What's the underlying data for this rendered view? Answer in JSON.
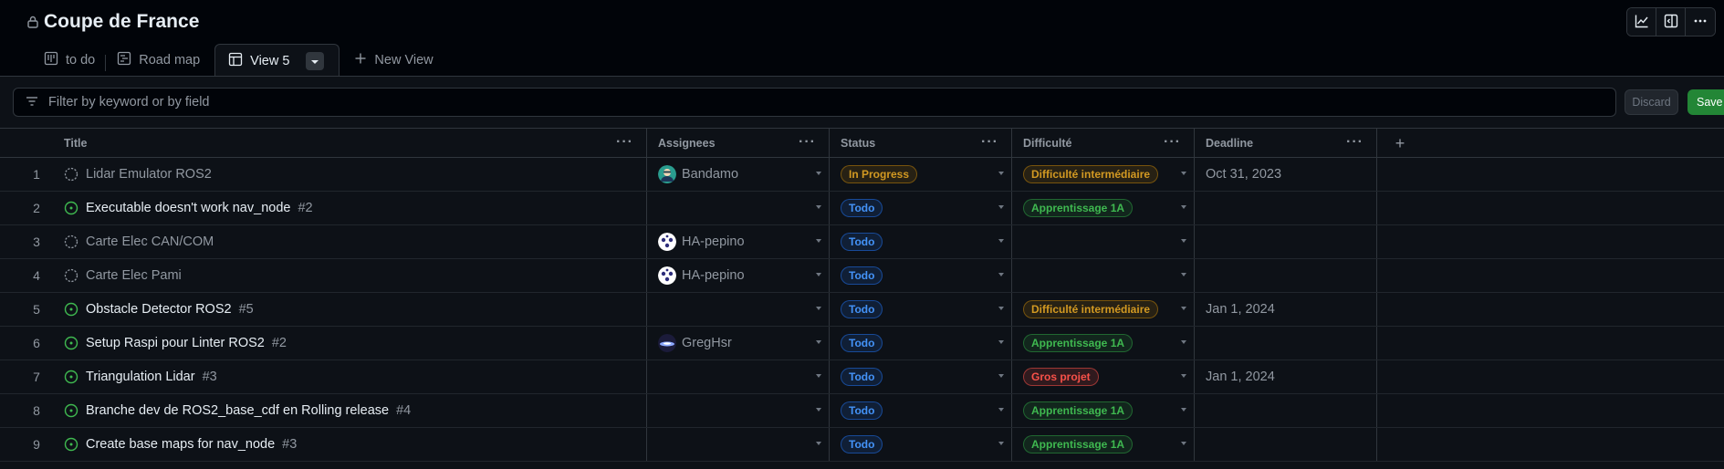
{
  "project": {
    "title": "Coupe de France",
    "lock_icon": "lock-icon"
  },
  "top_actions": [
    "graph-icon",
    "sidebar-icon",
    "kebab-icon"
  ],
  "tabs": [
    {
      "label": "to do",
      "icon": "board-icon"
    },
    {
      "label": "Road map",
      "icon": "roadmap-icon"
    },
    {
      "label": "View 5",
      "icon": "table-icon",
      "active": true
    },
    {
      "label": "New View",
      "icon": "plus-icon"
    }
  ],
  "filter": {
    "placeholder": "Filter by keyword or by field",
    "value": "",
    "discard_label": "Discard",
    "save_label": "Save"
  },
  "columns": {
    "title": "Title",
    "assignees": "Assignees",
    "status": "Status",
    "difficulty": "Difficulté",
    "deadline": "Deadline",
    "more": "···",
    "add": "+"
  },
  "rows": [
    {
      "num": "1",
      "title": "Lidar Emulator ROS2",
      "issue": "",
      "type": "draft",
      "assignee": "Bandamo",
      "avatar": "a1",
      "status": "In Progress",
      "status_kind": "inprogress",
      "difficulty": "Difficulté intermédiaire",
      "diff_kind": "inter",
      "deadline": "Oct 31, 2023"
    },
    {
      "num": "2",
      "title": "Executable doesn't work nav_node",
      "issue": "#2",
      "type": "issue",
      "assignee": "",
      "avatar": "",
      "status": "Todo",
      "status_kind": "todo",
      "difficulty": "Apprentissage 1A",
      "diff_kind": "app",
      "deadline": ""
    },
    {
      "num": "3",
      "title": "Carte Elec CAN/COM",
      "issue": "",
      "type": "draft",
      "assignee": "HA-pepino",
      "avatar": "a2",
      "status": "Todo",
      "status_kind": "todo",
      "difficulty": "",
      "diff_kind": "",
      "deadline": ""
    },
    {
      "num": "4",
      "title": "Carte Elec Pami",
      "issue": "",
      "type": "draft",
      "assignee": "HA-pepino",
      "avatar": "a2",
      "status": "Todo",
      "status_kind": "todo",
      "difficulty": "",
      "diff_kind": "",
      "deadline": ""
    },
    {
      "num": "5",
      "title": "Obstacle Detector ROS2",
      "issue": "#5",
      "type": "issue",
      "assignee": "",
      "avatar": "",
      "status": "Todo",
      "status_kind": "todo",
      "difficulty": "Difficulté intermédiaire",
      "diff_kind": "inter",
      "deadline": "Jan 1, 2024"
    },
    {
      "num": "6",
      "title": "Setup Raspi pour Linter ROS2",
      "issue": "#2",
      "type": "issue",
      "assignee": "GregHsr",
      "avatar": "a3",
      "status": "Todo",
      "status_kind": "todo",
      "difficulty": "Apprentissage 1A",
      "diff_kind": "app",
      "deadline": ""
    },
    {
      "num": "7",
      "title": "Triangulation Lidar",
      "issue": "#3",
      "type": "issue",
      "assignee": "",
      "avatar": "",
      "status": "Todo",
      "status_kind": "todo",
      "difficulty": "Gros projet",
      "diff_kind": "gros",
      "deadline": "Jan 1, 2024"
    },
    {
      "num": "8",
      "title": "Branche dev de ROS2_base_cdf en Rolling release",
      "issue": "#4",
      "type": "issue",
      "assignee": "",
      "avatar": "",
      "status": "Todo",
      "status_kind": "todo",
      "difficulty": "Apprentissage 1A",
      "diff_kind": "app",
      "deadline": ""
    },
    {
      "num": "9",
      "title": "Create base maps for nav_node",
      "issue": "#3",
      "type": "issue",
      "assignee": "",
      "avatar": "",
      "status": "Todo",
      "status_kind": "todo",
      "difficulty": "Apprentissage 1A",
      "diff_kind": "app",
      "deadline": ""
    }
  ],
  "colors": {
    "background": "#010409",
    "surface": "#0d1117",
    "border": "#30363d",
    "text": "#e6edf3",
    "muted": "#9198a1",
    "green": "#3fb950",
    "blue": "#4493f8",
    "yellow": "#d29922",
    "red": "#f85149",
    "save_bg": "#238636"
  }
}
